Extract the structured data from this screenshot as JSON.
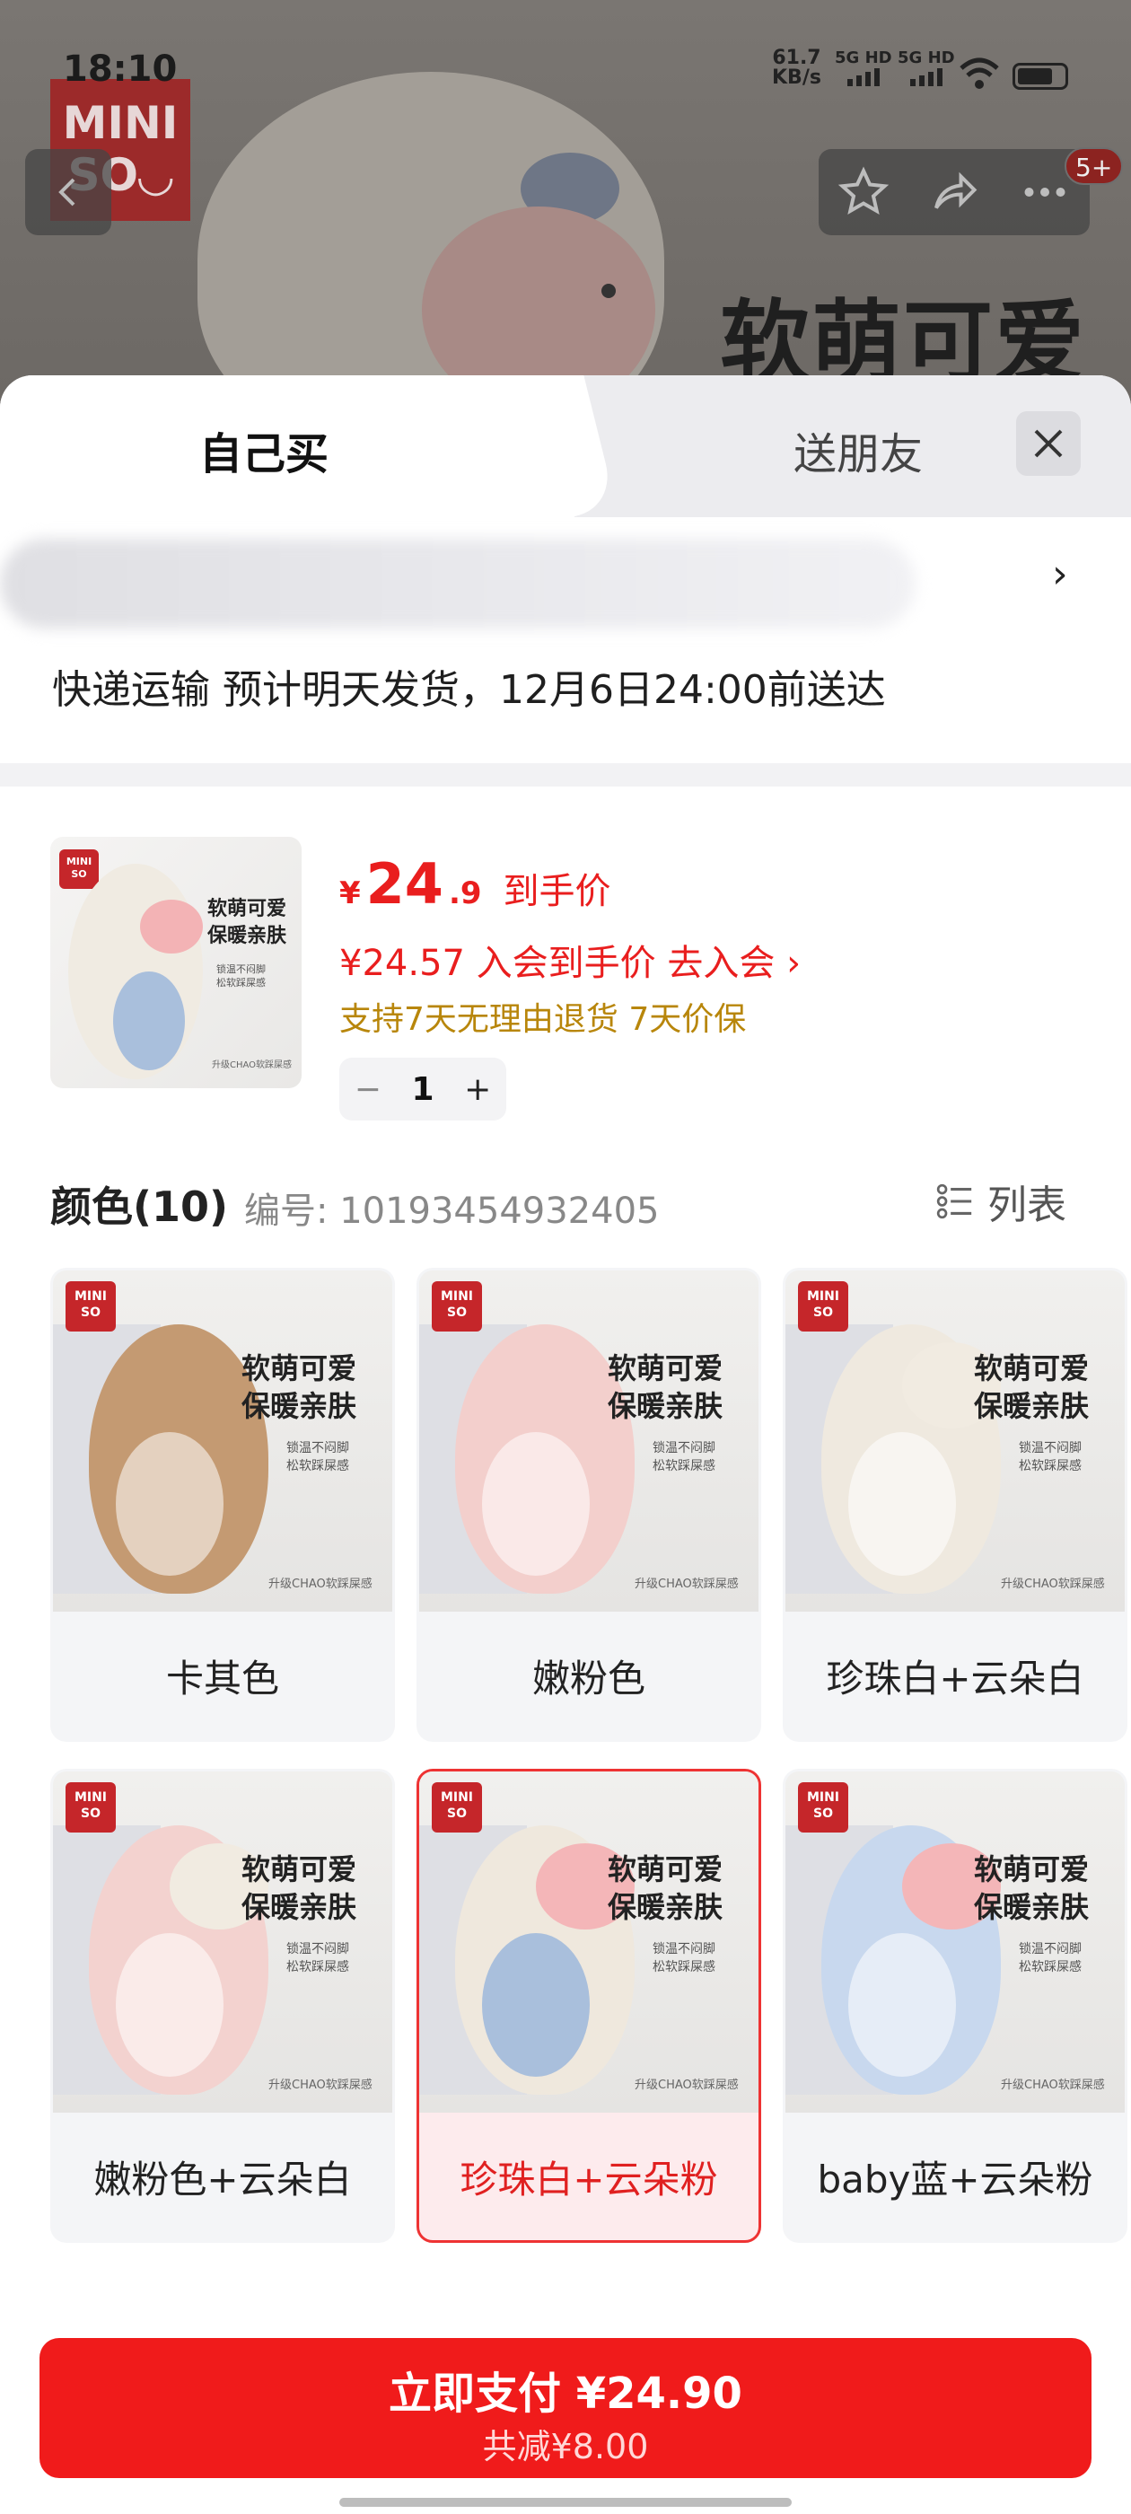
{
  "status_bar": {
    "time": "18:10",
    "net_speed_value": "61.7",
    "net_speed_unit": "KB/s",
    "sim1": "5G HD",
    "sim2": "5G HD"
  },
  "background": {
    "brand_logo": "MINI SO",
    "headline": "软萌可爱",
    "cart_badge": "5+"
  },
  "icons": {
    "back": "chevron-left-icon",
    "favorite": "star-icon",
    "share": "share-icon",
    "more": "more-icon",
    "close": "close-icon",
    "list": "list-icon"
  },
  "tabs": {
    "self": "自己买",
    "friend": "送朋友"
  },
  "address": {
    "arrow": "›"
  },
  "shipping": "快递运输 预计明天发货，12月6日24:00前送达",
  "product": {
    "price_symbol": "¥",
    "price_int": "24",
    "price_dec": ".9",
    "price_label": "到手价",
    "member_price": "¥24.57 入会到手价 去入会 ›",
    "guarantee": "支持7天无理由退货 7天价保",
    "quantity": "1",
    "minus": "−",
    "plus": "+",
    "image_tagline_1": "软萌可爱",
    "image_tagline_2": "保暖亲肤",
    "image_sub_1": "锁温不闷脚",
    "image_sub_2": "松软踩屎感",
    "image_foot": "升级CHAO软踩屎感"
  },
  "colors": {
    "heading": "颜色(10)",
    "sku_number": "编号: 10193454932405",
    "list_toggle": "列表",
    "selected_index": 4,
    "items": [
      {
        "label": "卡其色",
        "slipper_color": "#c49a72"
      },
      {
        "label": "嫩粉色",
        "slipper_color": "#f3cfcc"
      },
      {
        "label": "珍珠白+云朵白",
        "slipper_color": "#efe9df"
      },
      {
        "label": "嫩粉色+云朵白",
        "slipper_color": "#f3d2cf"
      },
      {
        "label": "珍珠白+云朵粉",
        "slipper_color": "#efe8dd"
      },
      {
        "label": "baby蓝+云朵粉",
        "slipper_color": "#c8d8ee"
      }
    ]
  },
  "pay": {
    "main": "立即支付 ¥24.90",
    "sub": "共减¥8.00",
    "color": "#f01b1b"
  }
}
